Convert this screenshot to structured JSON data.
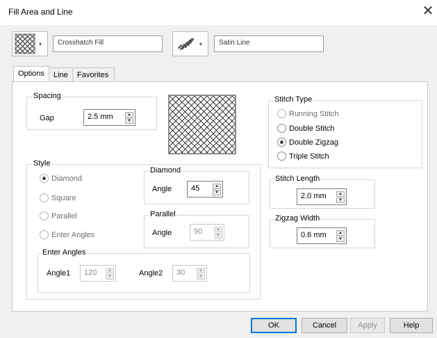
{
  "window": {
    "title": "Fill Area and Line",
    "close_glyph": "✕"
  },
  "fill": {
    "icon": "crosshatch-pattern-icon",
    "label": "Crosshatch Fill"
  },
  "line": {
    "icon": "satin-line-icon",
    "label": "Satin Line"
  },
  "tabs": [
    {
      "label": "Options",
      "active": true
    },
    {
      "label": "Line",
      "active": false
    },
    {
      "label": "Favorites",
      "active": false
    }
  ],
  "spacing": {
    "title": "Spacing",
    "gap_label": "Gap",
    "gap_value": "2.5 mm"
  },
  "style": {
    "title": "Style",
    "options": [
      {
        "label": "Diamond",
        "selected": true
      },
      {
        "label": "Square",
        "selected": false
      },
      {
        "label": "Parallel",
        "selected": false
      },
      {
        "label": "Enter Angles",
        "selected": false
      }
    ]
  },
  "diamond": {
    "title": "Diamond",
    "angle_label": "Angle",
    "angle_value": "45"
  },
  "parallel": {
    "title": "Parallel",
    "angle_label": "Angle",
    "angle_value": "90"
  },
  "enter_angles": {
    "title": "Enter Angles",
    "angle1_label": "Angle1",
    "angle1_value": "120",
    "angle2_label": "Angle2",
    "angle2_value": "30"
  },
  "stitch_type": {
    "title": "Stitch Type",
    "options": [
      {
        "label": "Running Stitch",
        "selected": false
      },
      {
        "label": "Double Stitch",
        "selected": false
      },
      {
        "label": "Double Zigzag",
        "selected": true
      },
      {
        "label": "Triple Stitch",
        "selected": false
      }
    ]
  },
  "stitch_length": {
    "title": "Stitch Length",
    "value": "2.0 mm"
  },
  "zigzag_width": {
    "title": "Zigzag Width",
    "value": "0.6 mm"
  },
  "buttons": {
    "ok": "OK",
    "cancel": "Cancel",
    "apply": "Apply",
    "help": "Help"
  },
  "spin_up": "▲",
  "spin_down": "▼",
  "dropdown_arrow": "▾"
}
